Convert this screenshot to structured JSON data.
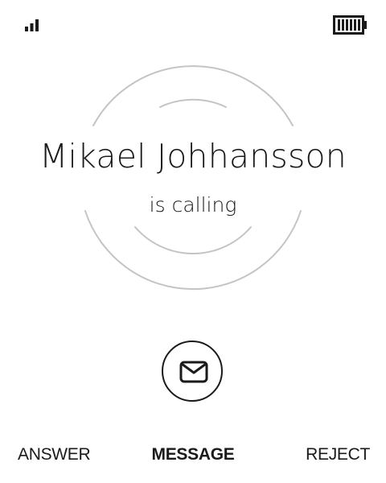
{
  "status_bar": {
    "signal_icon": "signal-bars-icon",
    "battery_icon": "battery-full-icon"
  },
  "call": {
    "caller_name": "Mikael Johhansson",
    "status_text": "is calling"
  },
  "action": {
    "message_icon": "envelope-icon"
  },
  "softkeys": {
    "left_label": "ANSWER",
    "center_label": "MESSAGE",
    "right_label": "REJECT"
  },
  "colors": {
    "foreground": "#1a1a1a",
    "ring": "#c4c4c4",
    "background": "#ffffff"
  }
}
